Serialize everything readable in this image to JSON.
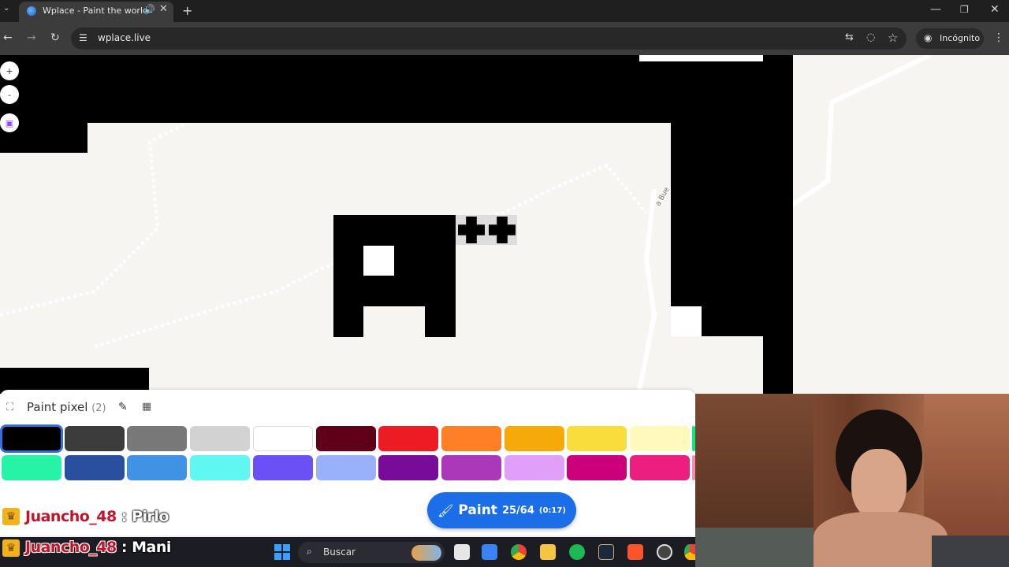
{
  "browser": {
    "tab_title": "Wplace - Paint the world",
    "url": "wplace.live",
    "incognito_label": "Incógnito"
  },
  "map": {
    "road_label": "a Bue"
  },
  "panel": {
    "title": "Paint pixel",
    "count": "(2)",
    "colors_row1": [
      "#000000",
      "#3c3c3c",
      "#787878",
      "#d2d2d2",
      "#ffffff",
      "#600018",
      "#ed1c24",
      "#ff7f27",
      "#f6aa09",
      "#f9dd3b",
      "#fffabc"
    ],
    "colors_row2": [
      "#27f3a6",
      "#28509e",
      "#4093e4",
      "#60f7f2",
      "#6b50f6",
      "#99b1fb",
      "#780c99",
      "#aa38b9",
      "#e09ff9",
      "#cb007a",
      "#ec1f80"
    ],
    "selected_color": "#000000"
  },
  "paint_button": {
    "label": "Paint",
    "count": "25/64",
    "time": "(0:17)"
  },
  "chat": [
    {
      "user": "Juancho_48",
      "sep": ":",
      "message": "Pirlo"
    },
    {
      "user": "Juancho_48",
      "sep": ":",
      "message": "Mani"
    }
  ],
  "taskbar": {
    "search_placeholder": "Buscar"
  }
}
